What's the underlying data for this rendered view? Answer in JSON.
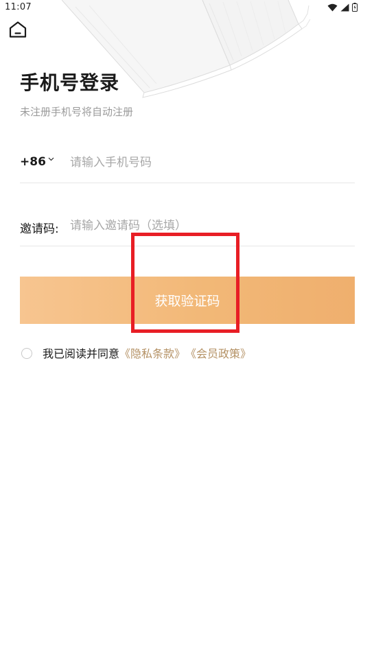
{
  "status_bar": {
    "time": "11:07"
  },
  "header": {
    "home_icon": "home-icon"
  },
  "login": {
    "title": "手机号登录",
    "subtitle": "未注册手机号将自动注册",
    "country_code": "+86",
    "phone_placeholder": "请输入手机号码",
    "phone_value": "",
    "invite_label": "邀请码:",
    "invite_placeholder": "请输入邀请码（选填）",
    "invite_value": "",
    "code_button_label": "获取验证码"
  },
  "agreement": {
    "text": "我已阅读并同意",
    "privacy_link": "《隐私条款》",
    "member_link": "《会员政策》",
    "checked": false
  },
  "colors": {
    "button_gradient_start": "#f7c590",
    "button_gradient_end": "#efaf6e",
    "link": "#b49164",
    "highlight": "#e81e25",
    "placeholder": "#a8a8a8",
    "subtitle": "#9a9a9a"
  }
}
